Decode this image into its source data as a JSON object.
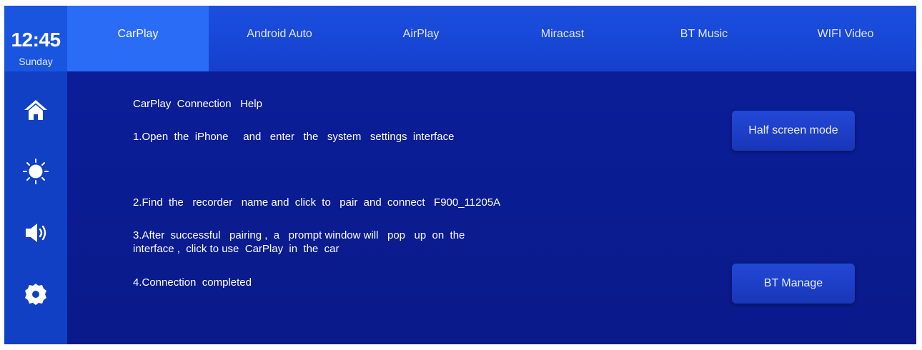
{
  "status": {
    "time": "12:45",
    "day": "Sunday"
  },
  "tabs": [
    {
      "label": "CarPlay",
      "active": true
    },
    {
      "label": "Android Auto",
      "active": false
    },
    {
      "label": "AirPlay",
      "active": false
    },
    {
      "label": "Miracast",
      "active": false
    },
    {
      "label": "BT Music",
      "active": false
    },
    {
      "label": "WIFI Video",
      "active": false
    }
  ],
  "sidebar": {
    "icons": [
      "home-icon",
      "brightness-icon",
      "volume-icon",
      "settings-icon"
    ]
  },
  "help": {
    "title": "CarPlay  Connection   Help",
    "step1": "1.Open  the  iPhone     and   enter   the   system   settings  interface",
    "step2": "2.Find  the   recorder   name and  click  to   pair  and  connect   F900_11205A",
    "step3_line1": "3.After  successful   pairing ,  a   prompt window will   pop   up  on  the",
    "step3_line2": "interface ,  click to use  CarPlay  in  the  car",
    "step4": "4.Connection  completed"
  },
  "buttons": {
    "half_screen": "Half screen mode",
    "bt_manage": "BT Manage"
  },
  "colors": {
    "background": "#0a1a8c",
    "rail": "#1240c4",
    "tab_bar": "#1b4fe0",
    "tab_active": "#2a6cf5"
  }
}
